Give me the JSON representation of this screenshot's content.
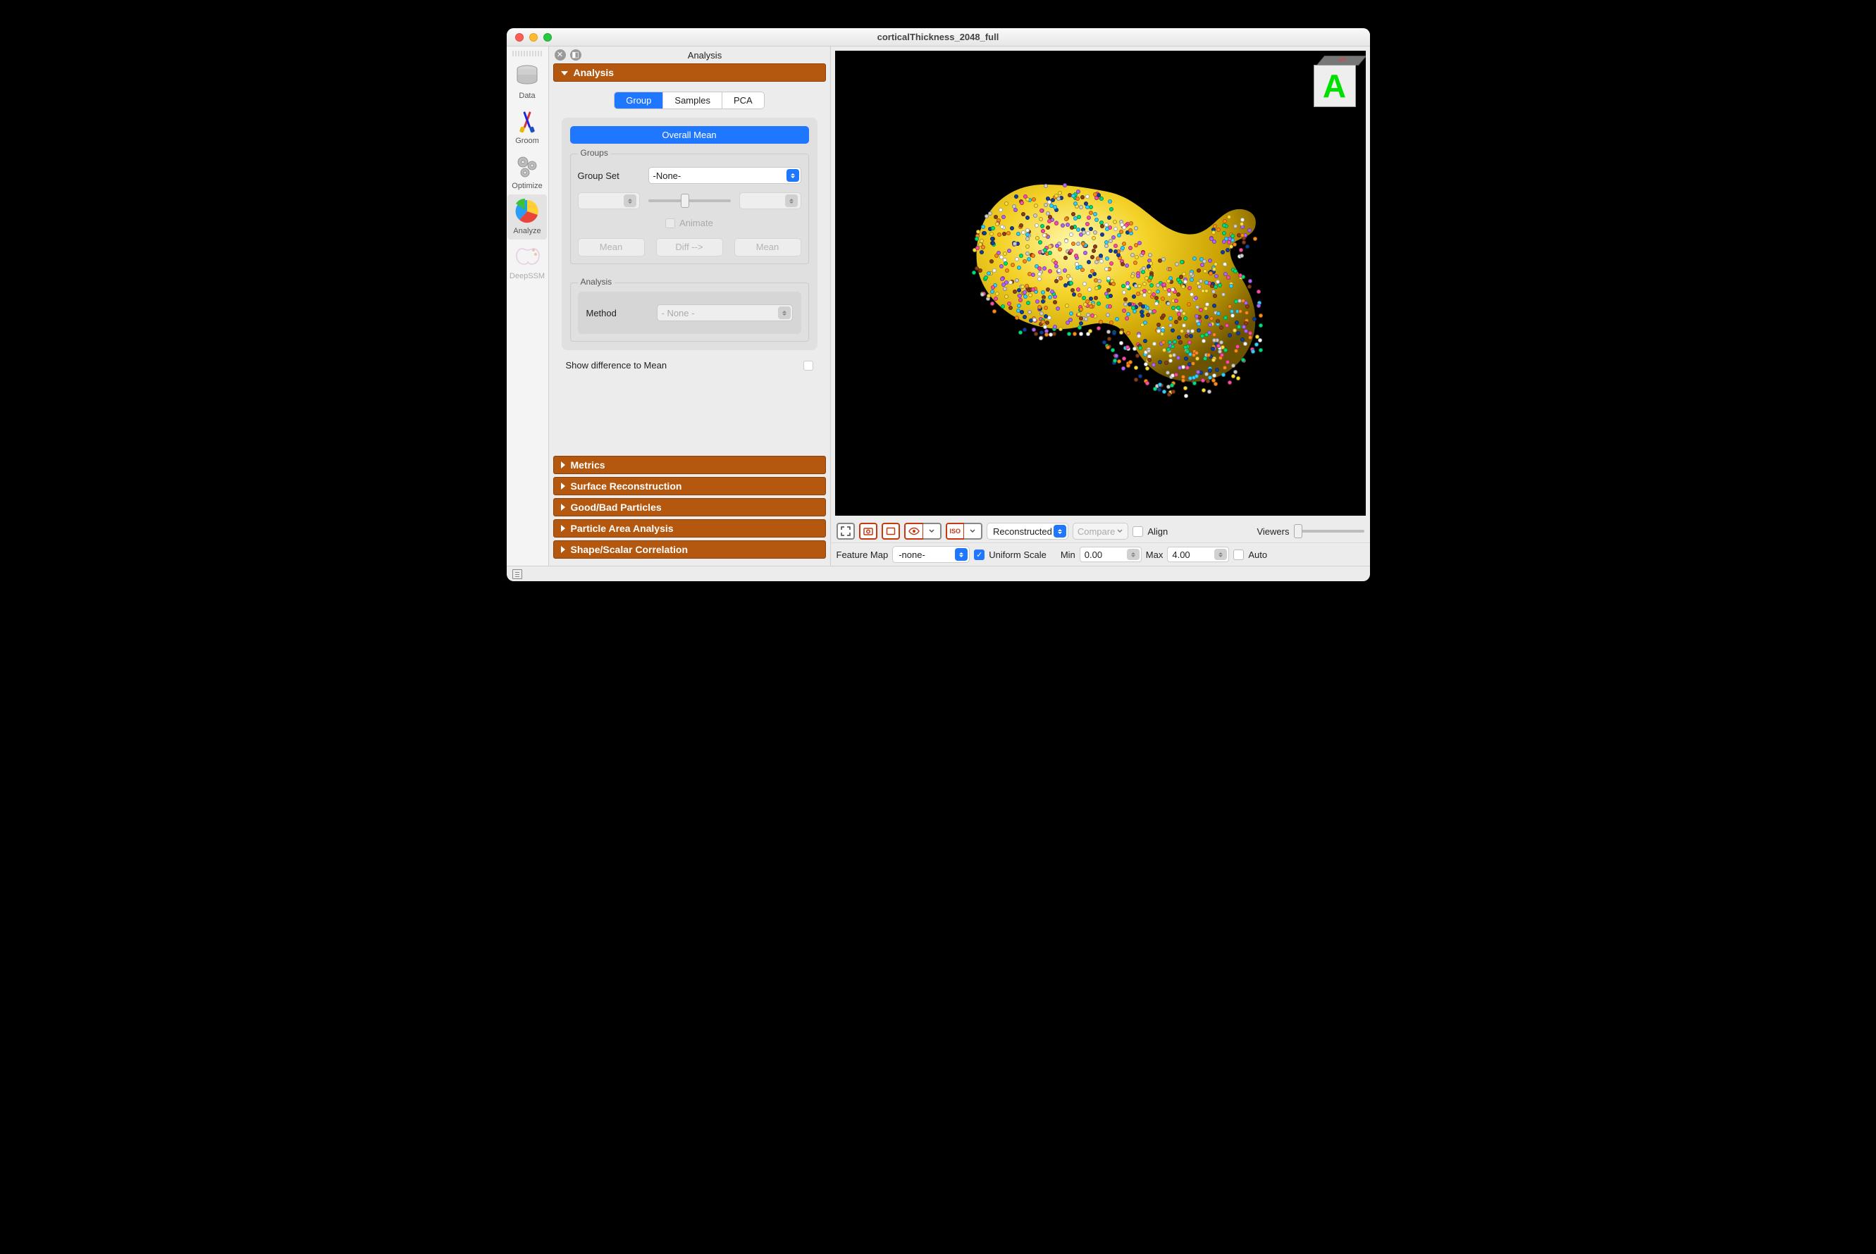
{
  "window_title": "corticalThickness_2048_full",
  "rail": [
    {
      "label": "Data"
    },
    {
      "label": "Groom"
    },
    {
      "label": "Optimize"
    },
    {
      "label": "Analyze"
    },
    {
      "label": "DeepSSM"
    }
  ],
  "panel_title": "Analysis",
  "accord_main": "Analysis",
  "tabs": {
    "group": "Group",
    "samples": "Samples",
    "pca": "PCA"
  },
  "overall_mean": "Overall Mean",
  "groups_legend": "Groups",
  "group_set_label": "Group Set",
  "group_set_value": "-None-",
  "animate_label": "Animate",
  "mean_btn": "Mean",
  "diff_btn": "Diff -->",
  "analysis_legend": "Analysis",
  "method_label": "Method",
  "method_value": "- None -",
  "show_diff_label": "Show difference to Mean",
  "accords": {
    "metrics": "Metrics",
    "surface": "Surface Reconstruction",
    "goodbad": "Good/Bad Particles",
    "area": "Particle Area Analysis",
    "corr": "Shape/Scalar Correlation"
  },
  "bottom": {
    "reconstructed": "Reconstructed",
    "compare": "Compare",
    "align": "Align",
    "viewers": "Viewers",
    "feature_map": "Feature Map",
    "feature_map_value": "-none-",
    "uniform": "Uniform Scale",
    "min_label": "Min",
    "min_value": "0.00",
    "max_label": "Max",
    "max_value": "4.00",
    "auto": "Auto",
    "iso": "ISO"
  },
  "orient_letter": "A"
}
